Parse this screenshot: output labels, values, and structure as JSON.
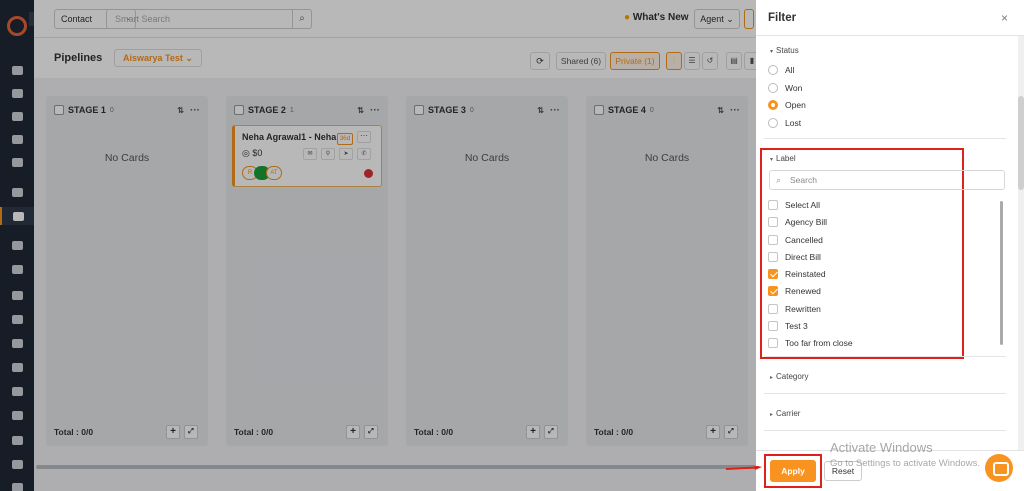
{
  "topbar": {
    "contact_select": "Contact",
    "search_placeholder": "Smart Search",
    "whats_new": "What's New",
    "agent_select": "Agent"
  },
  "pipeline": {
    "title": "Pipelines",
    "selected": "Aiswarya Test",
    "shared_label": "Shared (6)",
    "private_label": "Private (1)"
  },
  "stages": [
    {
      "name": "STAGE 1",
      "count": "0",
      "empty_text": "No Cards",
      "total": "Total : 0/0"
    },
    {
      "name": "STAGE 2",
      "count": "1",
      "empty_text": "",
      "total": "Total : 0/0"
    },
    {
      "name": "STAGE 3",
      "count": "0",
      "empty_text": "No Cards",
      "total": "Total : 0/0"
    },
    {
      "name": "STAGE 4",
      "count": "0",
      "empty_text": "No Cards",
      "total": "Total : 0/0"
    }
  ],
  "card": {
    "title": "Neha Agrawal1 - Neha",
    "badge": "36d",
    "amount": "$0",
    "tag1": "R",
    "tag2": "AT"
  },
  "filter": {
    "title": "Filter",
    "close": "×",
    "status": {
      "title": "Status",
      "options": [
        {
          "label": "All",
          "checked": false
        },
        {
          "label": "Won",
          "checked": false
        },
        {
          "label": "Open",
          "checked": true
        },
        {
          "label": "Lost",
          "checked": false
        }
      ]
    },
    "label": {
      "title": "Label",
      "search_placeholder": "Search",
      "options": [
        {
          "label": "Select All",
          "checked": false
        },
        {
          "label": "Agency Bill",
          "checked": false
        },
        {
          "label": "Cancelled",
          "checked": false
        },
        {
          "label": "Direct Bill",
          "checked": false
        },
        {
          "label": "Reinstated",
          "checked": true
        },
        {
          "label": "Renewed",
          "checked": true
        },
        {
          "label": "Rewritten",
          "checked": false
        },
        {
          "label": "Test 3",
          "checked": false
        },
        {
          "label": "Too far from close",
          "checked": false
        }
      ]
    },
    "category_title": "Category",
    "carrier_title": "Carrier",
    "apply_label": "Apply",
    "reset_label": "Reset"
  },
  "watermark": {
    "line1": "Activate Windows",
    "line2": "Go to Settings to activate Windows."
  },
  "colors": {
    "accent": "#f7931e",
    "highlight": "#e0201b",
    "sidebar": "#1f2937"
  }
}
